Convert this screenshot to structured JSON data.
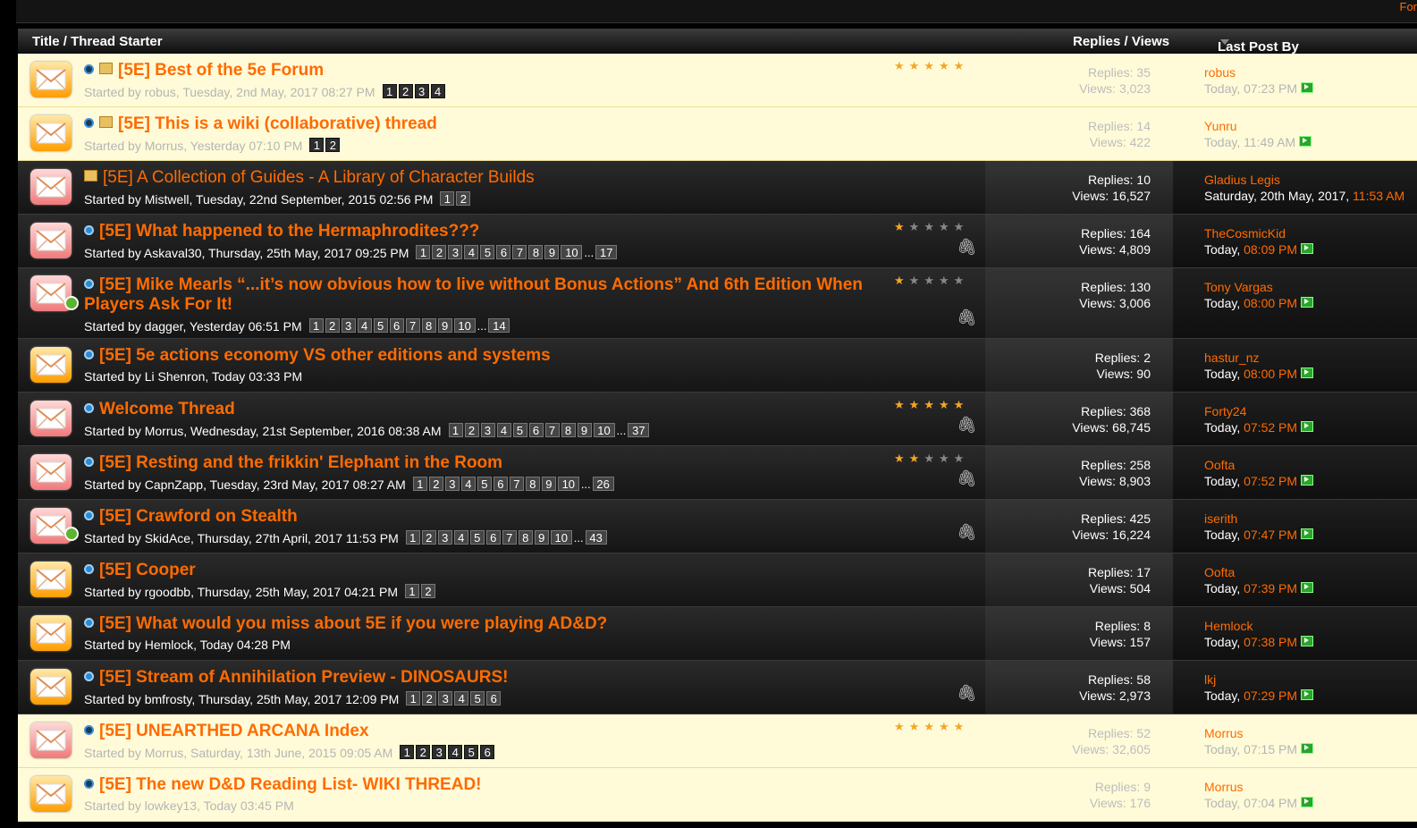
{
  "topbar": {
    "link_text": "For"
  },
  "header": {
    "title": "Title / Thread Starter",
    "replies_views": "Replies / Views",
    "last_post_by": "Last Post By"
  },
  "colors": {
    "accent": "#ff6b00",
    "sticky_bg": "#fffbd8",
    "row_dark": "#1f1f1f"
  },
  "threads": [
    {
      "style": "light",
      "env": "yellow",
      "prefix_icons": [
        "dot-icon",
        "sticky-icon"
      ],
      "title": "[5E] Best of the 5e Forum",
      "bold": true,
      "starter": "Started by robus, Tuesday, 2nd May, 2017 08:27 PM",
      "pages": [
        "1",
        "2",
        "3",
        "4"
      ],
      "rating": 5,
      "attach": false,
      "replies": "Replies: 35",
      "views": "Views: 3,023",
      "last_user": "robus",
      "last_when": "Today, 07:23 PM",
      "last_time": "",
      "h": 59
    },
    {
      "style": "light",
      "env": "yellow",
      "prefix_icons": [
        "dot-icon",
        "sticky-icon"
      ],
      "title": "[5E] This is a wiki (collaborative) thread",
      "bold": true,
      "starter": "Started by Morrus, Yesterday 07:10 PM",
      "pages": [
        "1",
        "2"
      ],
      "rating": 0,
      "attach": false,
      "replies": "Replies: 14",
      "views": "Views: 422",
      "last_user": "Yunru",
      "last_when": "Today, 11:49 AM",
      "last_time": "",
      "h": 59
    },
    {
      "style": "dark",
      "env": "pink",
      "prefix_icons": [
        "sticky-icon"
      ],
      "title": "[5E] A Collection of Guides - A Library of Character Builds",
      "bold": false,
      "starter": "Started by Mistwell, Tuesday, 22nd September, 2015 02:56 PM",
      "pages": [
        "1",
        "2"
      ],
      "rating": 0,
      "attach": false,
      "replies": "Replies: 10",
      "views": "Views: 16,527",
      "last_user": "Gladius Legis",
      "last_when": "Saturday, 20th May, 2017, ",
      "last_time": "11:53 AM",
      "h": 59
    },
    {
      "style": "dark",
      "env": "pink",
      "prefix_icons": [
        "dot-icon"
      ],
      "title": "[5E] What happened to the Hermaphrodites???",
      "bold": true,
      "starter": "Started by Askaval30, Thursday, 25th May, 2017 09:25 PM",
      "pages": [
        "1",
        "2",
        "3",
        "4",
        "5",
        "6",
        "7",
        "8",
        "9",
        "10",
        "...",
        "17"
      ],
      "rating": 1,
      "attach": true,
      "replies": "Replies: 164",
      "views": "Views: 4,809",
      "last_user": "TheCosmicKid",
      "last_when": "Today, ",
      "last_time": "08:09 PM",
      "h": 59
    },
    {
      "style": "dark",
      "env": "pink",
      "redirect": true,
      "prefix_icons": [
        "dot-icon"
      ],
      "title": "[5E] Mike Mearls “...it’s now obvious how to live without Bonus Actions” And 6th Edition When Players Ask For It!",
      "bold": true,
      "wrap": true,
      "starter": "Started by dagger, Yesterday 06:51 PM",
      "pages": [
        "1",
        "2",
        "3",
        "4",
        "5",
        "6",
        "7",
        "8",
        "9",
        "10",
        "...",
        "14"
      ],
      "rating": 1,
      "attach": true,
      "replies": "Replies: 130",
      "views": "Views: 3,006",
      "last_user": "Tony Vargas",
      "last_when": "Today, ",
      "last_time": "08:00 PM",
      "h": 78
    },
    {
      "style": "dark",
      "env": "yellow",
      "prefix_icons": [
        "dot-icon"
      ],
      "title": "[5E] 5e actions economy VS other editions and systems",
      "bold": true,
      "starter": "Started by Li Shenron, Today 03:33 PM",
      "pages": [],
      "rating": 0,
      "attach": false,
      "replies": "Replies: 2",
      "views": "Views: 90",
      "last_user": "hastur_nz",
      "last_when": "Today, ",
      "last_time": "08:00 PM",
      "h": 59
    },
    {
      "style": "dark",
      "env": "pink",
      "prefix_icons": [
        "dot-icon"
      ],
      "title": "Welcome Thread",
      "bold": true,
      "starter": "Started by Morrus, Wednesday, 21st September, 2016 08:38 AM",
      "pages": [
        "1",
        "2",
        "3",
        "4",
        "5",
        "6",
        "7",
        "8",
        "9",
        "10",
        "...",
        "37"
      ],
      "rating": 5,
      "attach": true,
      "replies": "Replies: 368",
      "views": "Views: 68,745",
      "last_user": "Forty24",
      "last_when": "Today, ",
      "last_time": "07:52 PM",
      "h": 59
    },
    {
      "style": "dark",
      "env": "pink",
      "prefix_icons": [
        "dot-icon"
      ],
      "title": "[5E] Resting and the frikkin' Elephant in the Room",
      "bold": true,
      "starter": "Started by CapnZapp, Tuesday, 23rd May, 2017 08:27 AM",
      "pages": [
        "1",
        "2",
        "3",
        "4",
        "5",
        "6",
        "7",
        "8",
        "9",
        "10",
        "...",
        "26"
      ],
      "rating": 2,
      "attach": true,
      "replies": "Replies: 258",
      "views": "Views: 8,903",
      "last_user": "Oofta",
      "last_when": "Today, ",
      "last_time": "07:52 PM",
      "h": 59
    },
    {
      "style": "dark",
      "env": "pink",
      "redirect": true,
      "prefix_icons": [
        "dot-icon"
      ],
      "title": "[5E] Crawford on Stealth",
      "bold": true,
      "starter": "Started by SkidAce, Thursday, 27th April, 2017 11:53 PM",
      "pages": [
        "1",
        "2",
        "3",
        "4",
        "5",
        "6",
        "7",
        "8",
        "9",
        "10",
        "...",
        "43"
      ],
      "rating": 0,
      "attach": true,
      "replies": "Replies: 425",
      "views": "Views: 16,224",
      "last_user": "iserith",
      "last_when": "Today, ",
      "last_time": "07:47 PM",
      "h": 59
    },
    {
      "style": "dark",
      "env": "yellow",
      "prefix_icons": [
        "dot-icon"
      ],
      "title": "[5E] Cooper",
      "bold": true,
      "starter": "Started by rgoodbb, Thursday, 25th May, 2017 04:21 PM",
      "pages": [
        "1",
        "2"
      ],
      "rating": 0,
      "attach": false,
      "replies": "Replies: 17",
      "views": "Views: 504",
      "last_user": "Oofta",
      "last_when": "Today, ",
      "last_time": "07:39 PM",
      "h": 59
    },
    {
      "style": "dark",
      "env": "yellow",
      "prefix_icons": [
        "dot-icon"
      ],
      "title": "[5E] What would you miss about 5E if you were playing AD&D?",
      "bold": true,
      "starter": "Started by Hemlock, Today 04:28 PM",
      "pages": [],
      "rating": 0,
      "attach": false,
      "replies": "Replies: 8",
      "views": "Views: 157",
      "last_user": "Hemlock",
      "last_when": "Today, ",
      "last_time": "07:38 PM",
      "h": 59
    },
    {
      "style": "dark",
      "env": "yellow",
      "prefix_icons": [
        "dot-icon"
      ],
      "title": "[5E] Stream of Annihilation Preview - DINOSAURS!",
      "bold": true,
      "starter": "Started by bmfrosty, Thursday, 25th May, 2017 12:09 PM",
      "pages": [
        "1",
        "2",
        "3",
        "4",
        "5",
        "6"
      ],
      "rating": 0,
      "attach": true,
      "replies": "Replies: 58",
      "views": "Views: 2,973",
      "last_user": "lkj",
      "last_when": "Today, ",
      "last_time": "07:29 PM",
      "h": 59
    },
    {
      "style": "light",
      "env": "pink",
      "prefix_icons": [
        "dot-icon"
      ],
      "title": "[5E] UNEARTHED ARCANA Index",
      "bold": true,
      "starter": "Started by Morrus, Saturday, 13th June, 2015 09:05 AM",
      "pages": [
        "1",
        "2",
        "3",
        "4",
        "5",
        "6"
      ],
      "rating": 5,
      "attach": false,
      "replies": "Replies: 52",
      "views": "Views: 32,605",
      "last_user": "Morrus",
      "last_when": "Today, 07:15 PM",
      "last_time": "",
      "h": 59
    },
    {
      "style": "light",
      "env": "yellow",
      "prefix_icons": [
        "dot-icon"
      ],
      "title": "[5E] The new D&D Reading List- WIKI THREAD!",
      "bold": true,
      "starter": "Started by lowkey13, Today 03:45 PM",
      "pages": [],
      "rating": 0,
      "attach": false,
      "replies": "Replies: 9",
      "views": "Views: 176",
      "last_user": "Morrus",
      "last_when": "Today, 07:04 PM",
      "last_time": "",
      "h": 59
    }
  ]
}
